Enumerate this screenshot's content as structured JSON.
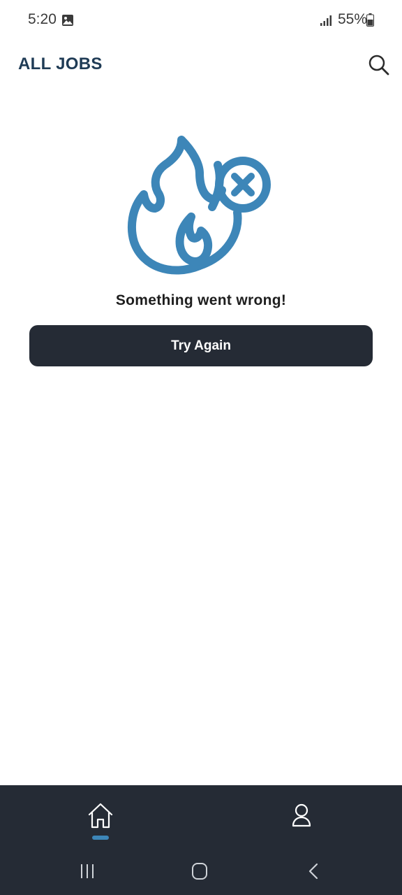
{
  "status_bar": {
    "time": "5:20",
    "battery": "55%",
    "icons": [
      "gallery-icon",
      "signal-icon",
      "battery-icon"
    ]
  },
  "header": {
    "title": "ALL JOBS",
    "search_icon": "search-icon"
  },
  "error": {
    "illustration_icon": "fire-error-icon",
    "message": "Something went wrong!",
    "button_label": "Try Again"
  },
  "bottom_nav": {
    "items": [
      {
        "icon": "home-icon",
        "active": true
      },
      {
        "icon": "user-icon",
        "active": false
      }
    ]
  },
  "system_nav": {
    "icons": [
      "recents-icon",
      "home-circle-icon",
      "back-icon"
    ]
  },
  "colors": {
    "accent": "#3d86b8",
    "title": "#1f3b55",
    "dark_bg": "#252b35",
    "background": "#ffffff"
  }
}
